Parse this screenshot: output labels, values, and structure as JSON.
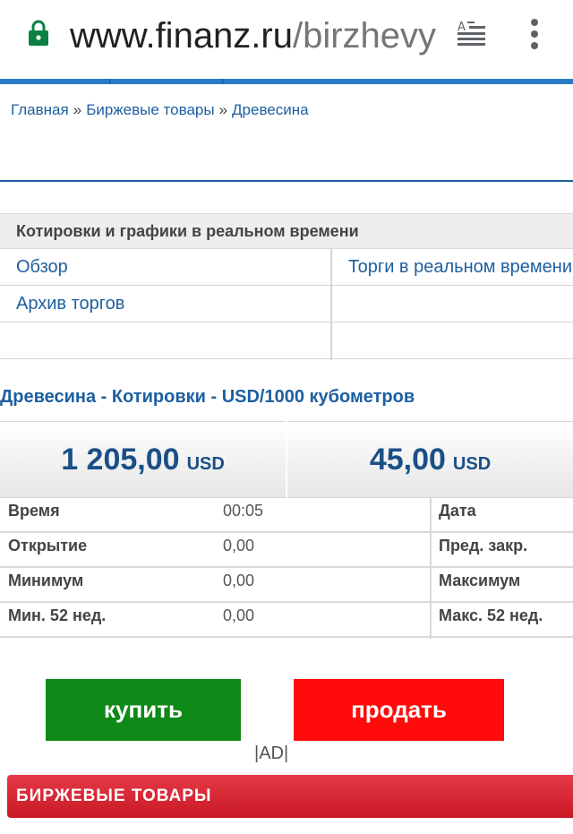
{
  "browser": {
    "url_domain": "www.finanz.ru",
    "url_path": "/birzhevy"
  },
  "breadcrumb": {
    "items": [
      "Главная",
      "Биржевые товары",
      "Древесина"
    ],
    "separator": "»"
  },
  "quotes_section": {
    "heading": "Котировки и графики в реальном времени",
    "links": [
      "Обзор",
      "Торги в реальном времени",
      "Архив торгов"
    ]
  },
  "quote": {
    "title": "Древесина - Котировки - USD/1000 кубометров",
    "price": "1 205,00",
    "price_currency": "USD",
    "change": "45,00",
    "change_currency": "USD"
  },
  "stats": [
    {
      "label": "Время",
      "value": "00:05",
      "label2": "Дата"
    },
    {
      "label": "Открытие",
      "value": "0,00",
      "label2": "Пред. закр."
    },
    {
      "label": "Минимум",
      "value": "0,00",
      "label2": "Максимум"
    },
    {
      "label": "Мин. 52 нед.",
      "value": "0,00",
      "label2": "Макс. 52 нед."
    }
  ],
  "actions": {
    "buy_label": "купить",
    "sell_label": "продать",
    "ad_label": "|AD|"
  },
  "category_bar": {
    "label": "БИРЖЕВЫЕ ТОВАРЫ"
  },
  "colors": {
    "link": "#1d5fa0",
    "buy": "#0f8a18",
    "sell": "#ff0b0b",
    "category": "#d42030",
    "accent_rule": "#2a7cc7",
    "lock": "#0b8043"
  }
}
